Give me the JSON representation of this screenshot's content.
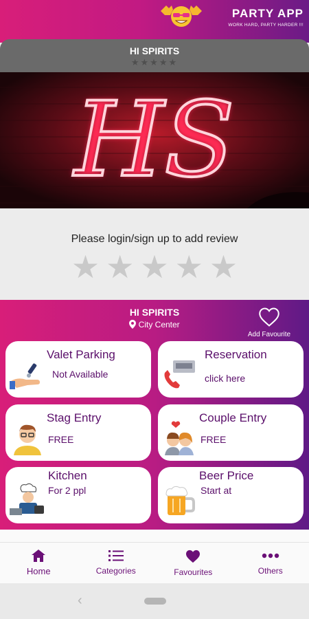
{
  "app": {
    "name": "PARTY APP",
    "tagline": "WORK HARD, PARTY HARDER !!!"
  },
  "venue": {
    "name": "HI SPIRITS",
    "rating_stars": "★★★★★",
    "hero_sign_text": "HS",
    "location": "City Center"
  },
  "review": {
    "prompt": "Please login/sign up to add review",
    "stars": [
      "★",
      "★",
      "★",
      "★",
      "★"
    ]
  },
  "favourite": {
    "label": "Add Favourite",
    "icon": "heart-outline-icon"
  },
  "cards": {
    "valet": {
      "title": "Valet Parking",
      "value": "Not Available",
      "icon": "valet-key-icon"
    },
    "reservation": {
      "title": "Reservation",
      "value": "click here",
      "icon": "phone-table-icon"
    },
    "stag": {
      "title": "Stag Entry",
      "value": "FREE",
      "icon": "man-avatar-icon"
    },
    "couple": {
      "title": "Couple Entry",
      "value": "FREE",
      "icon": "couple-heart-icon"
    },
    "kitchen": {
      "title": "Kitchen",
      "value": "For 2 ppl",
      "icon": "chef-icon"
    },
    "beer": {
      "title": "Beer Price",
      "value": "Start at",
      "icon": "beer-mug-icon"
    }
  },
  "nav": [
    {
      "label": "Home",
      "icon": "home-icon",
      "active": true
    },
    {
      "label": "Categories",
      "icon": "list-icon"
    },
    {
      "label": "Favourites",
      "icon": "heart-icon"
    },
    {
      "label": "Others",
      "icon": "more-dots-icon"
    }
  ],
  "colors": {
    "accent_pink": "#d81e79",
    "accent_purple": "#5f1a86",
    "text_purple": "#5a0e6a",
    "star_gray": "#c9c9c9"
  }
}
